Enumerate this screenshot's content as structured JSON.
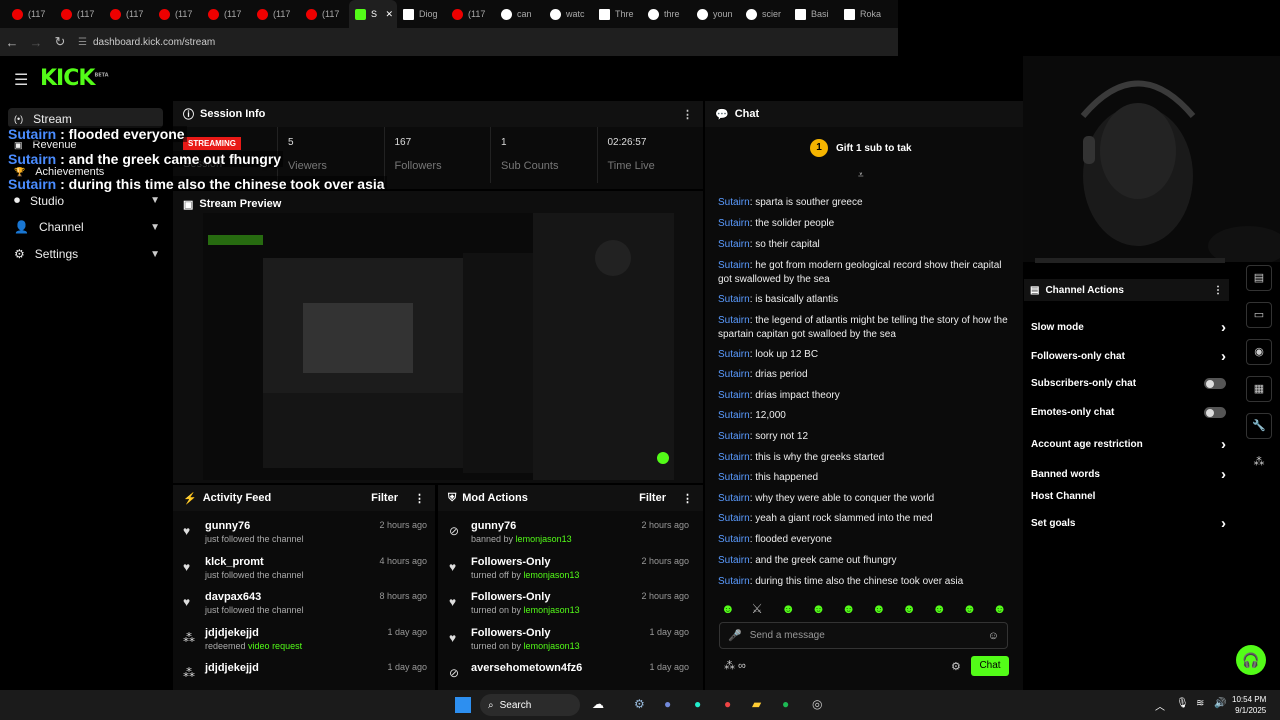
{
  "browser": {
    "tabs": [
      {
        "label": "(117",
        "icon": "youtube-icon"
      },
      {
        "label": "(117",
        "icon": "youtube-icon"
      },
      {
        "label": "(117",
        "icon": "youtube-icon"
      },
      {
        "label": "(117",
        "icon": "youtube-icon"
      },
      {
        "label": "(117",
        "icon": "youtube-icon"
      },
      {
        "label": "(117",
        "icon": "youtube-icon"
      },
      {
        "label": "(117",
        "icon": "youtube-icon"
      },
      {
        "label": "S",
        "icon": "kick-icon",
        "active": true
      },
      {
        "label": "Diog",
        "icon": "wikipedia-icon"
      },
      {
        "label": "(117",
        "icon": "youtube-icon"
      },
      {
        "label": "can",
        "icon": "google-icon"
      },
      {
        "label": "watc",
        "icon": "google-icon"
      },
      {
        "label": "Thre",
        "icon": "wikipedia-icon"
      },
      {
        "label": "thre",
        "icon": "google-icon"
      },
      {
        "label": "youn",
        "icon": "google-icon"
      },
      {
        "label": "scier",
        "icon": "google-icon"
      },
      {
        "label": "Basi",
        "icon": "wikipedia-icon"
      },
      {
        "label": "Roka",
        "icon": "wikipedia-icon"
      }
    ],
    "url": "dashboard.kick.com/stream"
  },
  "logo": {
    "text": "KICK",
    "sup": "BETA"
  },
  "sidebar": {
    "items": [
      {
        "label": "Stream"
      },
      {
        "label": "Revenue"
      },
      {
        "label": "Achievements"
      },
      {
        "label": "Studio"
      },
      {
        "label": "Channel"
      },
      {
        "label": "Settings"
      }
    ]
  },
  "session": {
    "title": "Session Info",
    "status": "STREAMING",
    "status_label": "Session",
    "viewers": "5",
    "viewers_label": "Viewers",
    "followers": "167",
    "followers_label": "Followers",
    "subs": "1",
    "subs_label": "Sub Counts",
    "time": "02:26:57",
    "time_label": "Time Live"
  },
  "preview": {
    "title": "Stream Preview"
  },
  "activity": {
    "title": "Activity Feed",
    "filter": "Filter",
    "items": [
      {
        "name": "gunny76",
        "text": "just followed the channel",
        "time": "2 hours ago"
      },
      {
        "name": "klck_promt",
        "text": "just followed the channel",
        "time": "4 hours ago"
      },
      {
        "name": "davpax643",
        "text": "just followed the channel",
        "time": "8 hours ago"
      },
      {
        "name": "jdjdjekejjd",
        "text": "redeemed",
        "extra": "video request",
        "time": "1 day ago"
      },
      {
        "name": "jdjdjekejjd",
        "text": "",
        "time": "1 day ago"
      }
    ]
  },
  "mod": {
    "title": "Mod Actions",
    "filter": "Filter",
    "items": [
      {
        "name": "gunny76",
        "text": "banned by",
        "by": "lemonjason13",
        "time": "2 hours ago"
      },
      {
        "name": "Followers-Only",
        "text": "turned off by",
        "by": "lemonjason13",
        "time": "2 hours ago"
      },
      {
        "name": "Followers-Only",
        "text": "turned on by",
        "by": "lemonjason13",
        "time": "2 hours ago"
      },
      {
        "name": "Followers-Only",
        "text": "turned on by",
        "by": "lemonjason13",
        "time": "1 day ago"
      },
      {
        "name": "aversehometown4fz6",
        "text": "",
        "by": "",
        "time": "1 day ago"
      }
    ]
  },
  "chat": {
    "title": "Chat",
    "gift": "Gift 1 sub to tak",
    "gift_count": "1",
    "messages": [
      {
        "user": "Sutairn",
        "text": "sparta is souther greece"
      },
      {
        "user": "Sutairn",
        "text": "the solider people"
      },
      {
        "user": "Sutairn",
        "text": "so their capital"
      },
      {
        "user": "Sutairn",
        "text": "he got from modern geological record show their capital got swallowed by the sea"
      },
      {
        "user": "Sutairn",
        "text": "is basically atlantis"
      },
      {
        "user": "Sutairn",
        "text": "the legend of atlantis might be telling the story of how the spartain capitan got swalloed by the sea"
      },
      {
        "user": "Sutairn",
        "text": "look up 12 BC"
      },
      {
        "user": "Sutairn",
        "text": "drias period"
      },
      {
        "user": "Sutairn",
        "text": "drias impact theory"
      },
      {
        "user": "Sutairn",
        "text": "12,000"
      },
      {
        "user": "Sutairn",
        "text": "sorry not 12"
      },
      {
        "user": "Sutairn",
        "text": "this is why the greeks started"
      },
      {
        "user": "Sutairn",
        "text": "this happened"
      },
      {
        "user": "Sutairn",
        "text": "why they were able to conquer the world"
      },
      {
        "user": "Sutairn",
        "text": "yeah a giant rock slammed into the med"
      },
      {
        "user": "Sutairn",
        "text": "flooded everyone"
      },
      {
        "user": "Sutairn",
        "text": "and the greek came out fhungry"
      },
      {
        "user": "Sutairn",
        "text": "during this time also the chinese took over asia"
      }
    ],
    "placeholder": "Send a message",
    "send": "Chat"
  },
  "overlay": [
    {
      "user": "Sutairn",
      "text": " : flooded everyone"
    },
    {
      "user": "Sutairn",
      "text": " : and the greek came out fhungry"
    },
    {
      "user": "Sutairn",
      "text": " : during this time also the chinese took over asia"
    }
  ],
  "channel_actions": {
    "title": "Channel Actions",
    "items": [
      {
        "label": "Slow mode",
        "control": "chevron"
      },
      {
        "label": "Followers-only chat",
        "control": "chevron"
      },
      {
        "label": "Subscribers-only chat",
        "control": "toggle"
      },
      {
        "label": "Emotes-only chat",
        "control": "toggle"
      },
      {
        "label": "Account age restriction",
        "control": "chevron"
      },
      {
        "label": "Banned words",
        "control": "chevron"
      },
      {
        "label": "Host Channel",
        "control": "none"
      },
      {
        "label": "Set goals",
        "control": "chevron"
      }
    ]
  },
  "taskbar": {
    "search": "Search",
    "time": "10:54 PM",
    "date": "9/1/2025"
  },
  "colors": {
    "accent": "#53fc18",
    "username": "#5a9bff",
    "live": "#e91916"
  }
}
